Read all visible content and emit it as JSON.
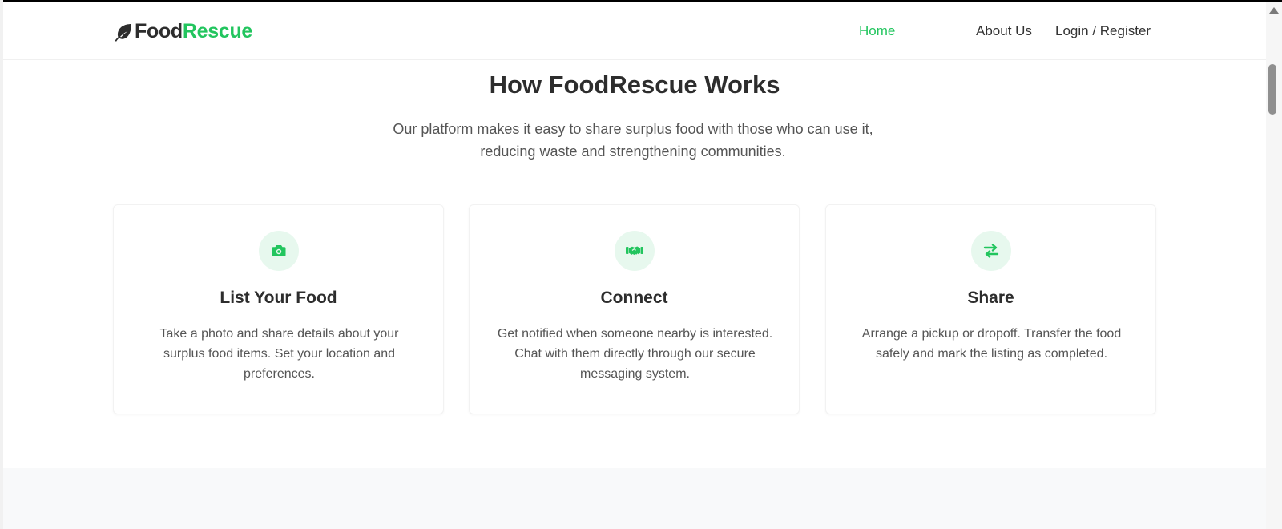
{
  "brand": {
    "name_part1": "Food",
    "name_part2": "Rescue",
    "icon": "leaf-icon",
    "accent_color": "#22c55e"
  },
  "nav": {
    "home": "Home",
    "about": "About Us",
    "login": "Login / Register"
  },
  "section": {
    "title": "How FoodRescue Works",
    "subtitle": "Our platform makes it easy to share surplus food with those who can use it, reducing waste and strengthening communities."
  },
  "steps": [
    {
      "icon": "camera-icon",
      "title": "List Your Food",
      "text": "Take a photo and share details about your surplus food items. Set your location and preferences."
    },
    {
      "icon": "handshake-icon",
      "title": "Connect",
      "text": "Get notified when someone nearby is interested. Chat with them directly through our secure messaging system."
    },
    {
      "icon": "exchange-icon",
      "title": "Share",
      "text": "Arrange a pickup or dropoff. Transfer the food safely and mark the listing as completed."
    }
  ]
}
